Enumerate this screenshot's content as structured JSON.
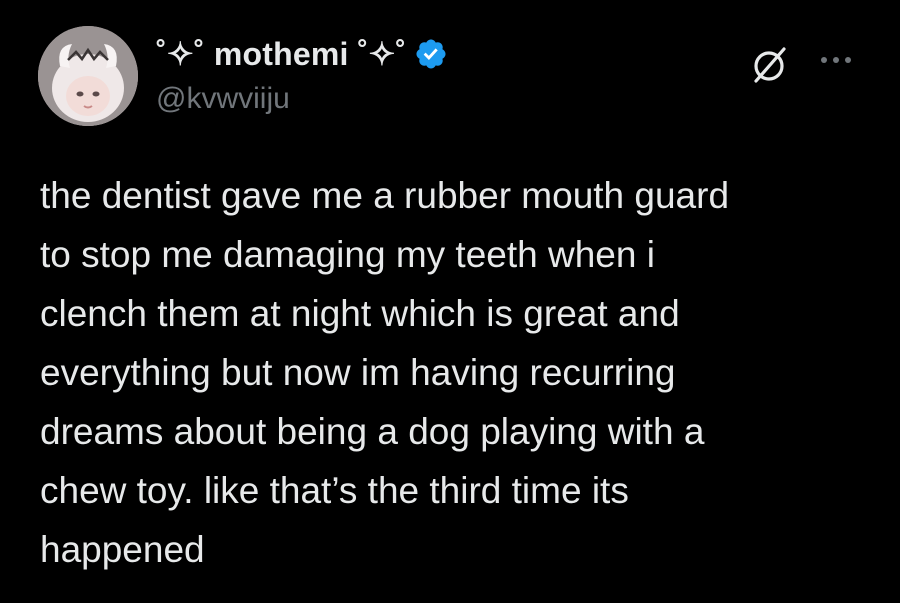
{
  "theme": {
    "background": "#000000",
    "text": "#e7e9ea",
    "secondary_text": "#71767b",
    "verified_badge": "#1d9bf0"
  },
  "author": {
    "display_name": "˚✧˚ mothemi ˚✧˚",
    "handle": "@kvwviiju",
    "verified": true,
    "avatar_icon": "avatar-image",
    "verified_icon": "verified-badge-icon"
  },
  "actions": {
    "grok_icon": "grok-icon",
    "more_icon": "more-options-icon"
  },
  "tweet": {
    "text": "the dentist gave me a rubber mouth guard\nto stop me damaging my teeth when i\nclench them at night which is great and\neverything but now im having recurring\ndreams about being a dog playing with a\nchew toy. like that’s the third time its\nhappened"
  }
}
